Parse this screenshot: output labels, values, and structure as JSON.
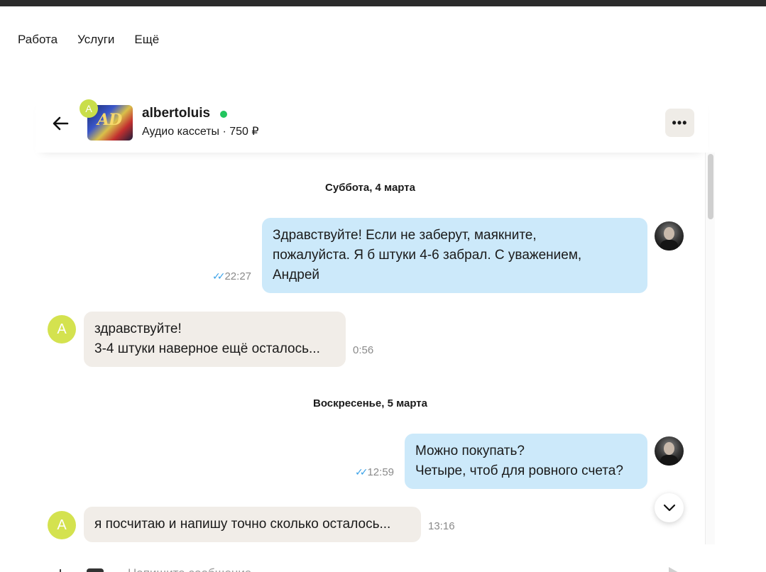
{
  "nav": {
    "items": [
      "Работа",
      "Услуги",
      "Ещё"
    ]
  },
  "header": {
    "seller_name": "albertoluis",
    "seller_initial": "A",
    "listing": "Аудио кассеты · 750 ₽",
    "thumbnail_text": "AD",
    "more_label": "•••",
    "online_color": "#22c55e"
  },
  "days": [
    "Суббота, 4 марта",
    "Воскресенье, 5 марта"
  ],
  "messages": [
    {
      "direction": "out",
      "lines": [
        "Здравствуйте! Если не заберут, маякните,",
        "пожалуйста. Я б штуки 4-6 забрал. С уважением,",
        "Андрей"
      ],
      "time": "22:27",
      "read": true
    },
    {
      "direction": "in",
      "lines": [
        "здравствуйте!",
        "3-4 штуки наверное ещё осталось..."
      ],
      "time": "0:56"
    },
    {
      "direction": "out",
      "lines": [
        "Можно покупать?",
        "Четыре, чтоб для ровного счета?"
      ],
      "time": "12:59",
      "read": true
    },
    {
      "direction": "in",
      "lines": [
        "я посчитаю и напишу точно сколько осталось..."
      ],
      "time": "13:16"
    }
  ],
  "incoming_avatar_initial": "A",
  "composer": {
    "placeholder": "Напишите сообщение"
  },
  "colors": {
    "outgoing_bubble": "#cce9fa",
    "incoming_bubble": "#f1ede8",
    "avatar_lime": "#d4e24f",
    "read_ticks": "#3aa2e8"
  }
}
